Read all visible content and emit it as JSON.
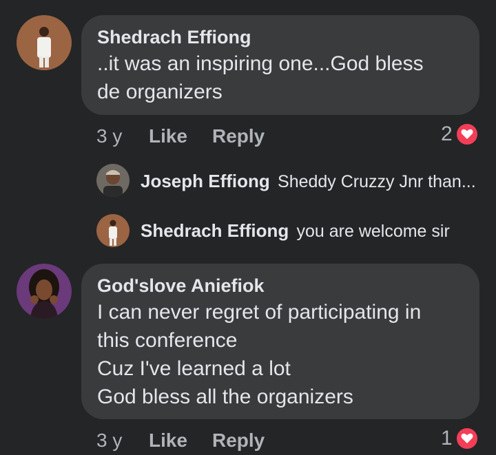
{
  "comments": [
    {
      "author": "Shedrach Effiong",
      "lines": [
        "..it was an inspiring one...God bless",
        "de organizers"
      ],
      "time": "3 y",
      "like": "Like",
      "reply": "Reply",
      "reactions": "2"
    },
    {
      "author": "God'slove Aniefiok",
      "lines": [
        "I can never regret of participating in",
        "this conference",
        "Cuz I've learned a lot",
        "God bless all the organizers"
      ],
      "time": "3 y",
      "like": "Like",
      "reply": "Reply",
      "reactions": "1"
    }
  ],
  "replies": [
    {
      "author": "Joseph Effiong",
      "text": "Sheddy Cruzzy Jnr than..."
    },
    {
      "author": "Shedrach Effiong",
      "text": "you are welcome sir"
    }
  ],
  "colors": {
    "background": "#242526",
    "bubble": "#3a3b3c",
    "text": "#e4e6eb",
    "muted": "#b0b3b8",
    "heart": "#f33e58"
  }
}
